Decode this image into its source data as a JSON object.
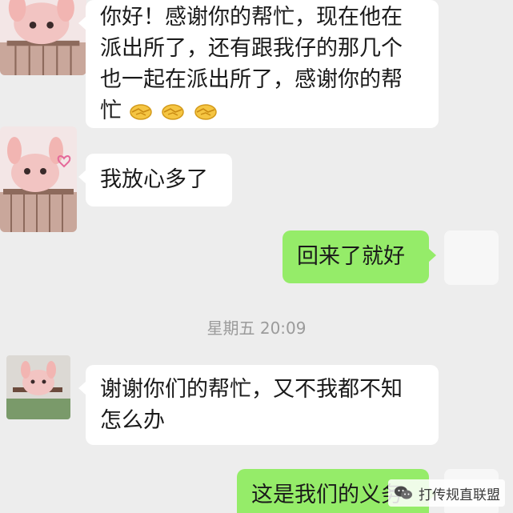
{
  "messages": [
    {
      "side": "in",
      "lines": [
        "你好！感谢你的帮忙，现在他在",
        "派出所了，还有跟我仔的那几个",
        "也一起在派出所了，感谢你的帮",
        "忙"
      ],
      "emoji": "handshake-icon"
    },
    {
      "side": "in",
      "text": "我放心多了"
    },
    {
      "side": "out",
      "text": "回来了就好"
    },
    {
      "side": "in",
      "lines": [
        "谢谢你们的帮忙，又不我都不知",
        "怎么办"
      ]
    },
    {
      "side": "out",
      "text": "这是我们的义务"
    }
  ],
  "timestamp": "星期五 20:09",
  "watermark": {
    "text": "打传规直联盟",
    "icon": "wechat-icon"
  },
  "colors": {
    "background": "#ededed",
    "incoming_bubble": "#ffffff",
    "outgoing_bubble": "#95ec69",
    "timestamp": "#9b9b9b",
    "avatar_pink": "#f0b8b8"
  }
}
